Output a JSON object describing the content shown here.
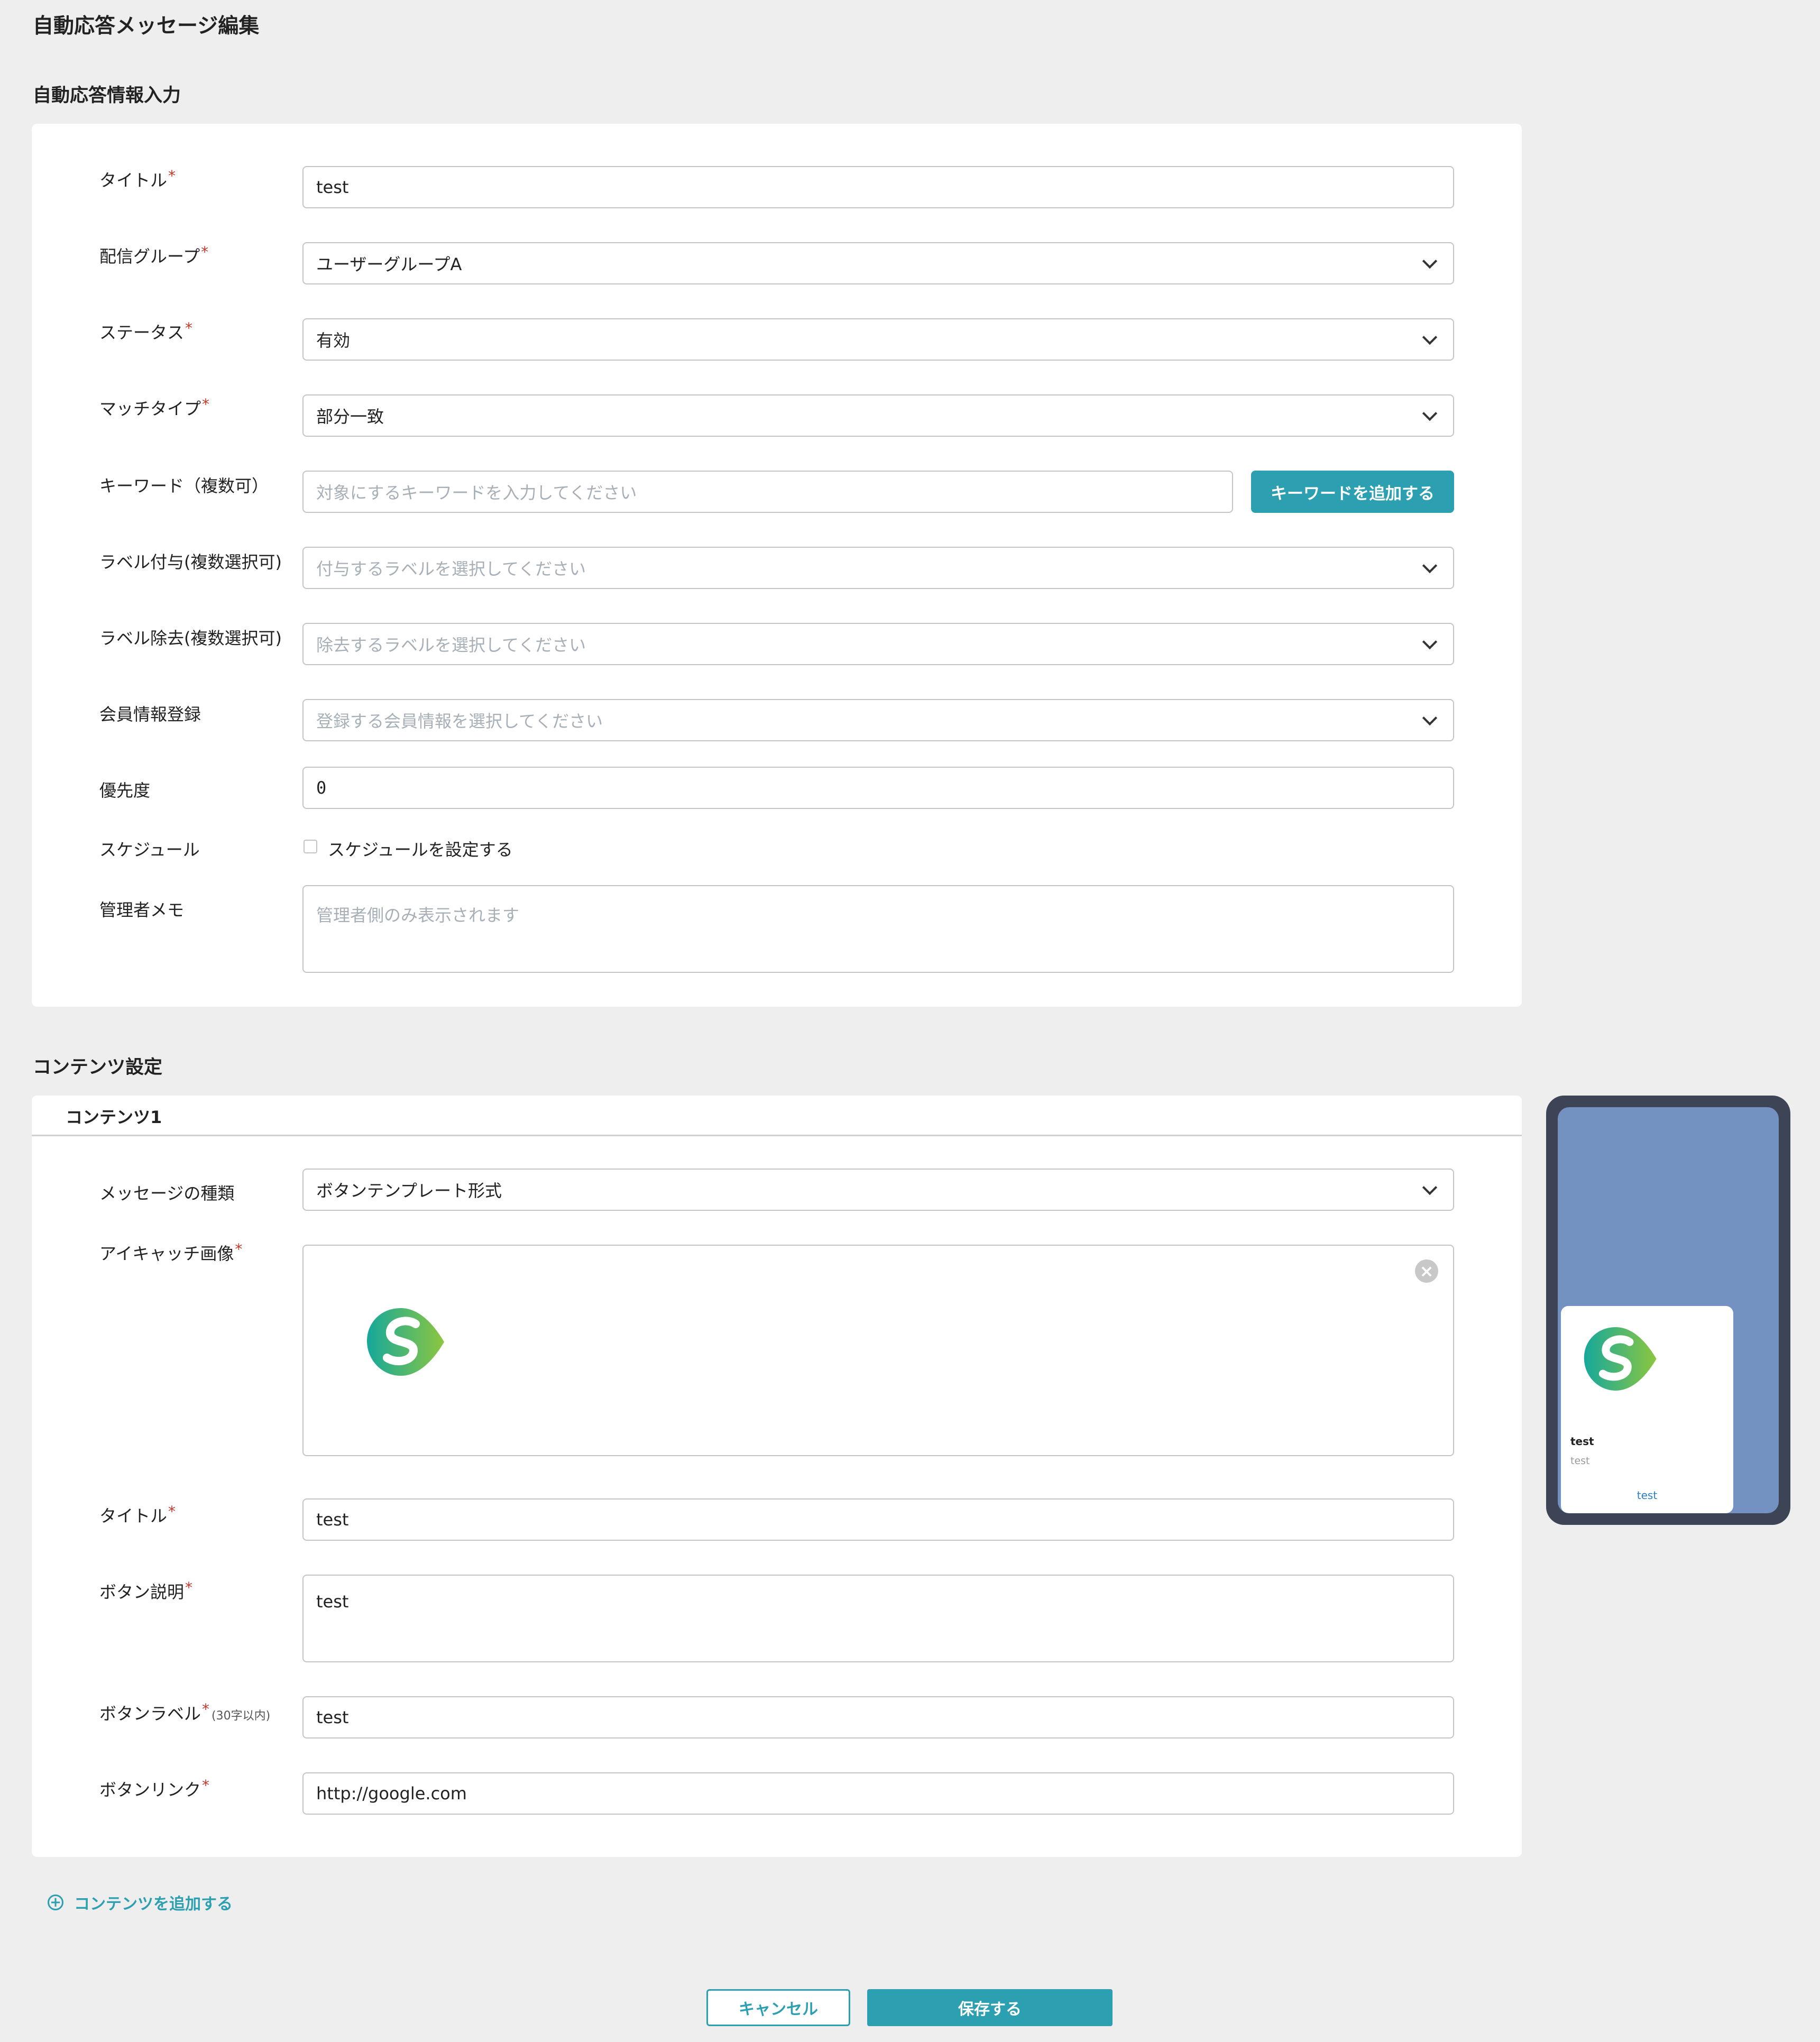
{
  "page_title": "自動応答メッセージ編集",
  "section1": {
    "title": "自動応答情報入力",
    "fields": {
      "title": {
        "label": "タイトル",
        "value": "test"
      },
      "group": {
        "label": "配信グループ",
        "value": "ユーザーグループA"
      },
      "status": {
        "label": "ステータス",
        "value": "有効"
      },
      "match_type": {
        "label": "マッチタイプ",
        "value": "部分一致"
      },
      "keyword": {
        "label": "キーワード（複数可）",
        "placeholder": "対象にするキーワードを入力してください",
        "button": "キーワードを追加する"
      },
      "label_add": {
        "label": "ラベル付与(複数選択可)",
        "placeholder": "付与するラベルを選択してください"
      },
      "label_remove": {
        "label": "ラベル除去(複数選択可)",
        "placeholder": "除去するラベルを選択してください"
      },
      "member_info": {
        "label": "会員情報登録",
        "placeholder": "登録する会員情報を選択してください"
      },
      "priority": {
        "label": "優先度",
        "value": "0"
      },
      "schedule": {
        "label": "スケジュール",
        "checkbox_label": "スケジュールを設定する"
      },
      "memo": {
        "label": "管理者メモ",
        "placeholder": "管理者側のみ表示されます"
      }
    },
    "required_mark": "*"
  },
  "section2": {
    "title": "コンテンツ設定",
    "tab_label": "コンテンツ1",
    "fields": {
      "message_type": {
        "label": "メッセージの種類",
        "value": "ボタンテンプレート形式"
      },
      "eyecatch": {
        "label": "アイキャッチ画像"
      },
      "title": {
        "label": "タイトル",
        "value": "test"
      },
      "button_desc": {
        "label": "ボタン説明",
        "value": "test"
      },
      "button_label": {
        "label": "ボタンラベル",
        "hint": "(30字以内)",
        "value": "test"
      },
      "button_link": {
        "label": "ボタンリンク",
        "value": "http://google.com"
      }
    },
    "add_content": "コンテンツを追加する"
  },
  "preview": {
    "title": "test",
    "text": "test",
    "button": "test"
  },
  "footer": {
    "cancel": "キャンセル",
    "save": "保存する"
  },
  "colors": {
    "accent": "#2c9fb1",
    "required": "#c0392b",
    "phone_frame": "#3c4456",
    "phone_screen": "#7391c1"
  }
}
